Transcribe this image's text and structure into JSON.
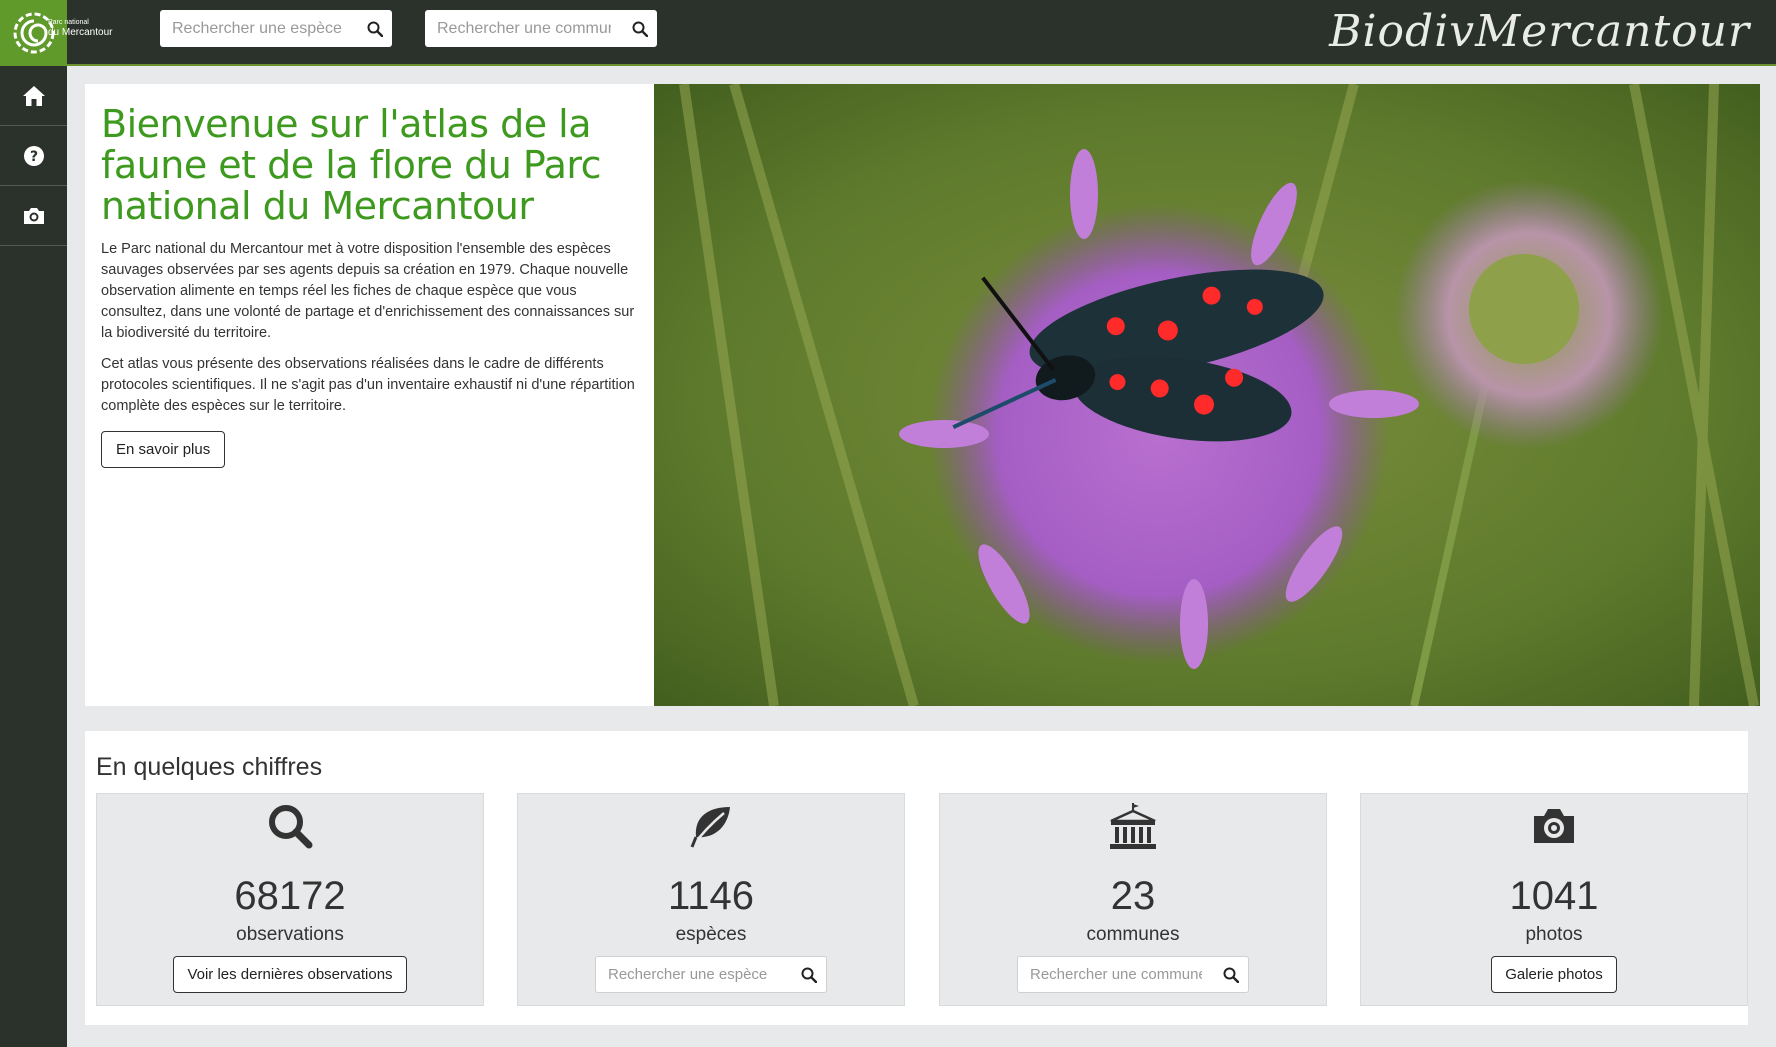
{
  "logo": {
    "line1": "Parc national",
    "line2": "du Mercantour"
  },
  "header": {
    "search_species": {
      "placeholder": "Rechercher une espèce"
    },
    "search_commune": {
      "placeholder": "Rechercher une commune"
    },
    "brand": "BiodivMercantour"
  },
  "nav": {
    "items": [
      {
        "icon": "home-icon"
      },
      {
        "icon": "help-icon"
      },
      {
        "icon": "camera-icon"
      }
    ]
  },
  "hero": {
    "title": "Bienvenue sur l'atlas de la faune et de la flore du Parc national du Mercantour",
    "p1": "Le Parc national du Mercantour met à votre disposition l'ensemble des espèces sauvages observées par ses agents depuis sa création en 1979. Chaque nouvelle observation alimente en temps réel les fiches de chaque espèce que vous consultez, dans une volonté de partage et d'enrichissement des connaissances sur la biodiversité du territoire.",
    "p2": "Cet atlas vous présente des observations réalisées dans le cadre de différents protocoles scientifiques. Il ne s'agit pas d'un inventaire exhaustif ni d'une répartition complète des espèces sur le territoire.",
    "button": "En savoir plus"
  },
  "stats": {
    "title": "En quelques chiffres",
    "cards": [
      {
        "icon": "search-icon",
        "value": "68172",
        "label": "observations",
        "button": "Voir les dernières observations"
      },
      {
        "icon": "leaf-icon",
        "value": "1146",
        "label": "espèces",
        "search_placeholder": "Rechercher une espèce"
      },
      {
        "icon": "townhall-icon",
        "value": "23",
        "label": "communes",
        "search_placeholder": "Rechercher une commune"
      },
      {
        "icon": "camera-icon",
        "value": "1041",
        "label": "photos",
        "button": "Galerie photos"
      }
    ]
  },
  "colors": {
    "accent": "#3d9a1f",
    "dark": "#2a322b",
    "logo_bg": "#5f9a2a"
  }
}
